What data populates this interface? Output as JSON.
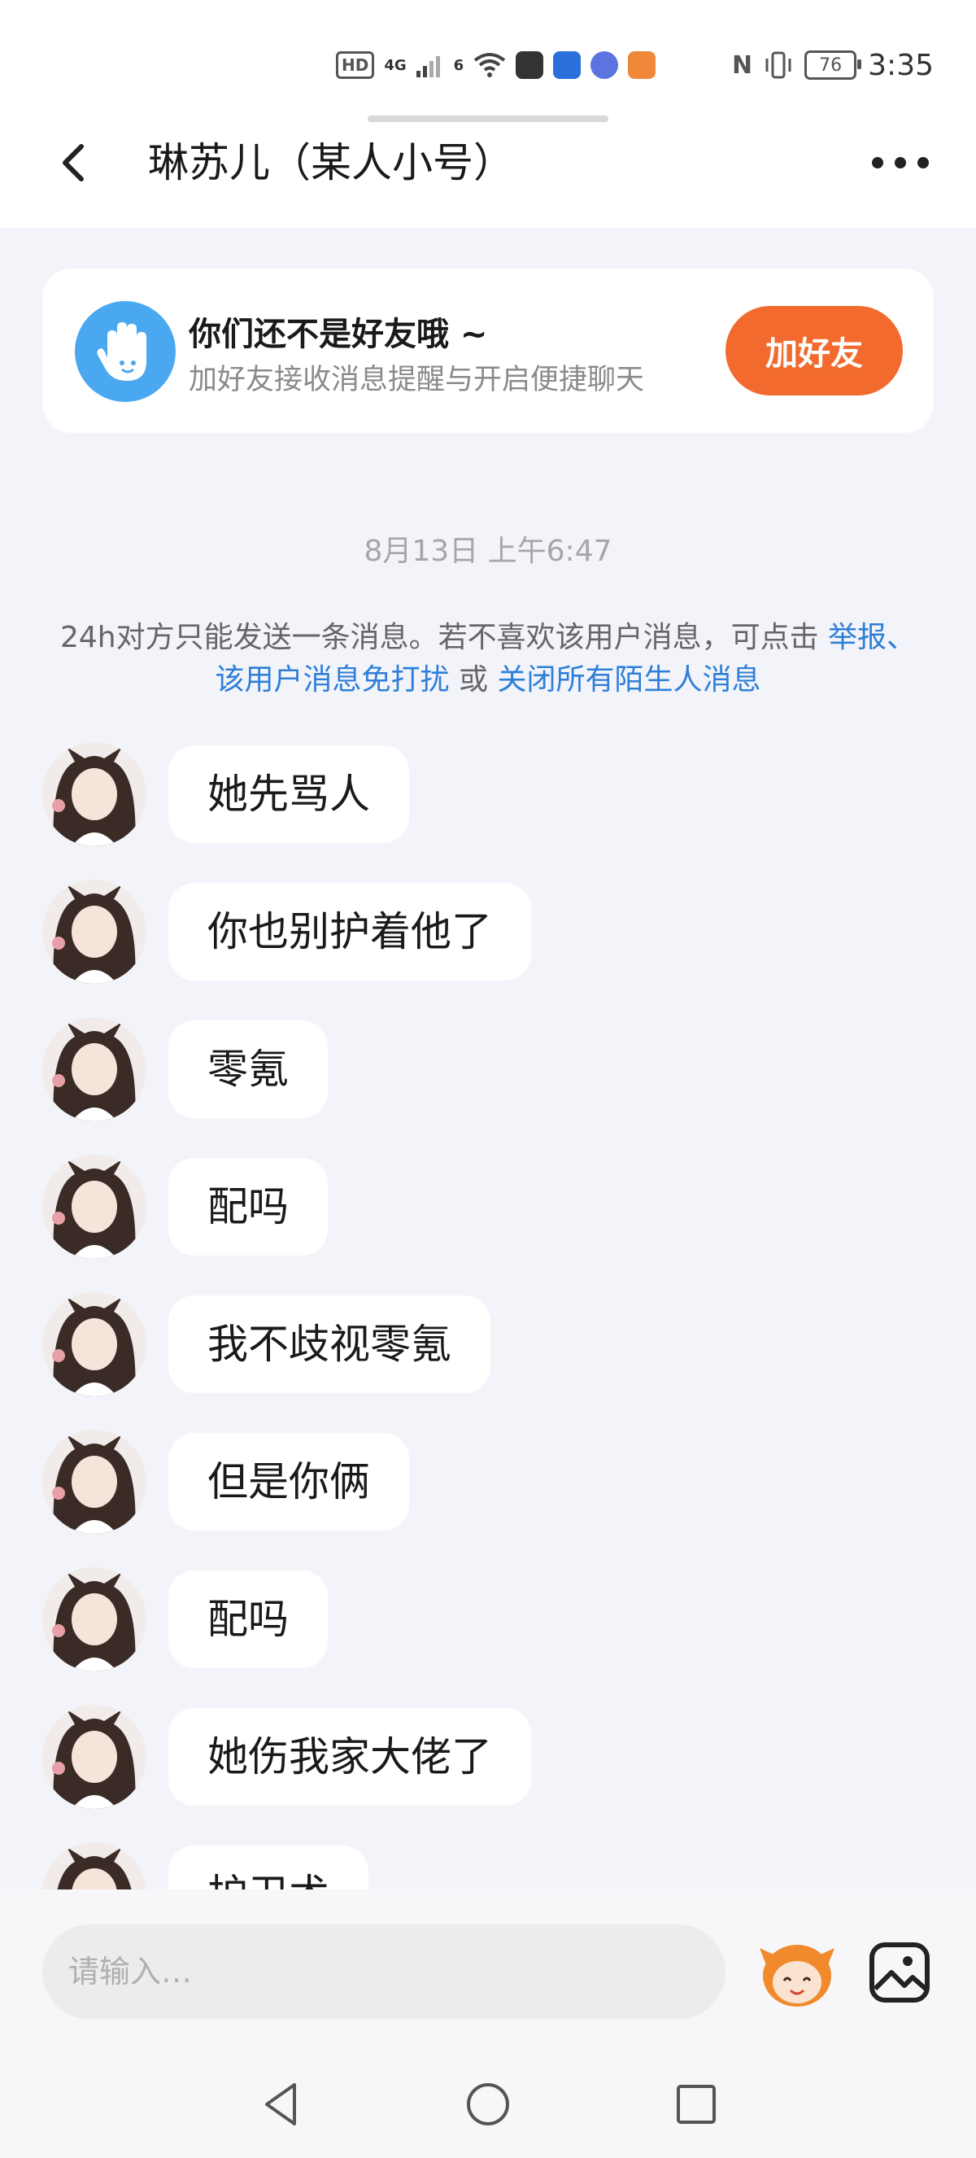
{
  "status_bar": {
    "hd_label": "HD",
    "signal_label": "4G",
    "wifi_label": "6",
    "battery": "76",
    "time": "3:35"
  },
  "header": {
    "title": "琳苏儿（某人小号）",
    "back_icon": "chevron-left-icon",
    "more_icon": "more-dots-icon"
  },
  "friend_banner": {
    "title": "你们还不是好友哦 ~",
    "subtitle": "加好友接收消息提醒与开启便捷聊天",
    "button": "加好友",
    "accent": "#f26a2e",
    "icon": "hand-wave-icon"
  },
  "timestamp": "8月13日 上午6:47",
  "notice": {
    "text": "24h对方只能发送一条消息。若不喜欢该用户消息，可点击",
    "link1": "举报",
    "sep": "、",
    "link2": "该用户消息免打扰",
    "or": "或",
    "link3": "关闭所有陌生人消息",
    "link_color": "#2f7fd8"
  },
  "messages": [
    "她先骂人",
    "你也别护着他了",
    "零氪",
    "配吗",
    "我不歧视零氪",
    "但是你俩",
    "配吗",
    "她伤我家大佬了",
    "护卫术"
  ],
  "input": {
    "placeholder": "请输入…",
    "emoji_icon": "mascot-emoji-icon",
    "image_icon": "image-icon"
  },
  "nav_bar": {
    "back": "triangle-back-icon",
    "home": "circle-home-icon",
    "recent": "square-recent-icon"
  }
}
